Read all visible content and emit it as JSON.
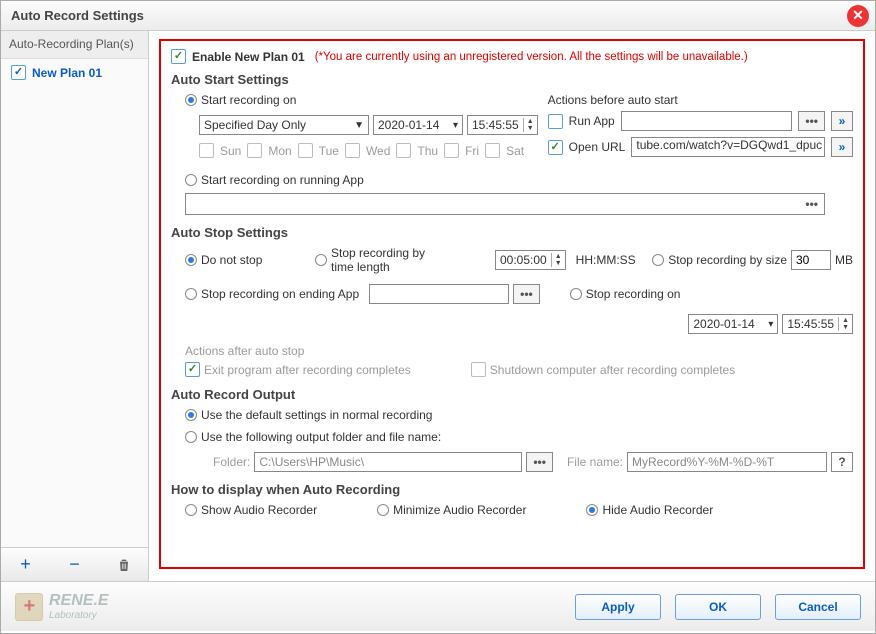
{
  "title": "Auto Record Settings",
  "sidebar": {
    "header": "Auto-Recording Plan(s)",
    "item1": "New Plan 01",
    "add_tip": "+",
    "remove_tip": "−"
  },
  "enable": {
    "label": "Enable New Plan 01",
    "warning": "(*You are currently using an unregistered version. All the settings will be unavailable.)"
  },
  "autostart": {
    "title": "Auto Start Settings",
    "opt_on": "Start recording on",
    "mode": "Specified Day Only",
    "date": "2020-01-14",
    "time": "15:45:55",
    "days": {
      "sun": "Sun",
      "mon": "Mon",
      "tue": "Tue",
      "wed": "Wed",
      "thu": "Thu",
      "fri": "Fri",
      "sat": "Sat"
    },
    "opt_app": "Start recording on running App",
    "actions_label": "Actions before auto start",
    "runapp_label": "Run App",
    "openurl_label": "Open URL",
    "url_value": "tube.com/watch?v=DGQwd1_dpuc"
  },
  "autostop": {
    "title": "Auto Stop Settings",
    "donot": "Do not stop",
    "bytime_label": "Stop recording by time length",
    "bytime_value": "00:05:00",
    "bytime_suffix": "HH:MM:SS",
    "bysize_label": "Stop recording by size",
    "bysize_value": "30",
    "bysize_suffix": "MB",
    "endapp_label": "Stop recording on ending App",
    "stopon_label": "Stop recording on",
    "stopon_date": "2020-01-14",
    "stopon_time": "15:45:55",
    "afterstop_title": "Actions after auto stop",
    "exit_label": "Exit program after recording completes",
    "shutdown_label": "Shutdown computer after recording completes"
  },
  "output": {
    "title": "Auto Record Output",
    "default_label": "Use the default settings in normal recording",
    "custom_label": "Use the following output folder and file name:",
    "folder_label": "Folder:",
    "folder_value": "C:\\Users\\HP\\Music\\",
    "filename_label": "File name:",
    "filename_value": "MyRecord%Y-%M-%D-%T"
  },
  "display": {
    "title": "How to display when Auto Recording",
    "show": "Show Audio Recorder",
    "minimize": "Minimize Audio Recorder",
    "hide": "Hide Audio Recorder"
  },
  "logo": {
    "brand": "RENE.E",
    "sub": "Laboratory"
  },
  "buttons": {
    "apply": "Apply",
    "ok": "OK",
    "cancel": "Cancel"
  }
}
